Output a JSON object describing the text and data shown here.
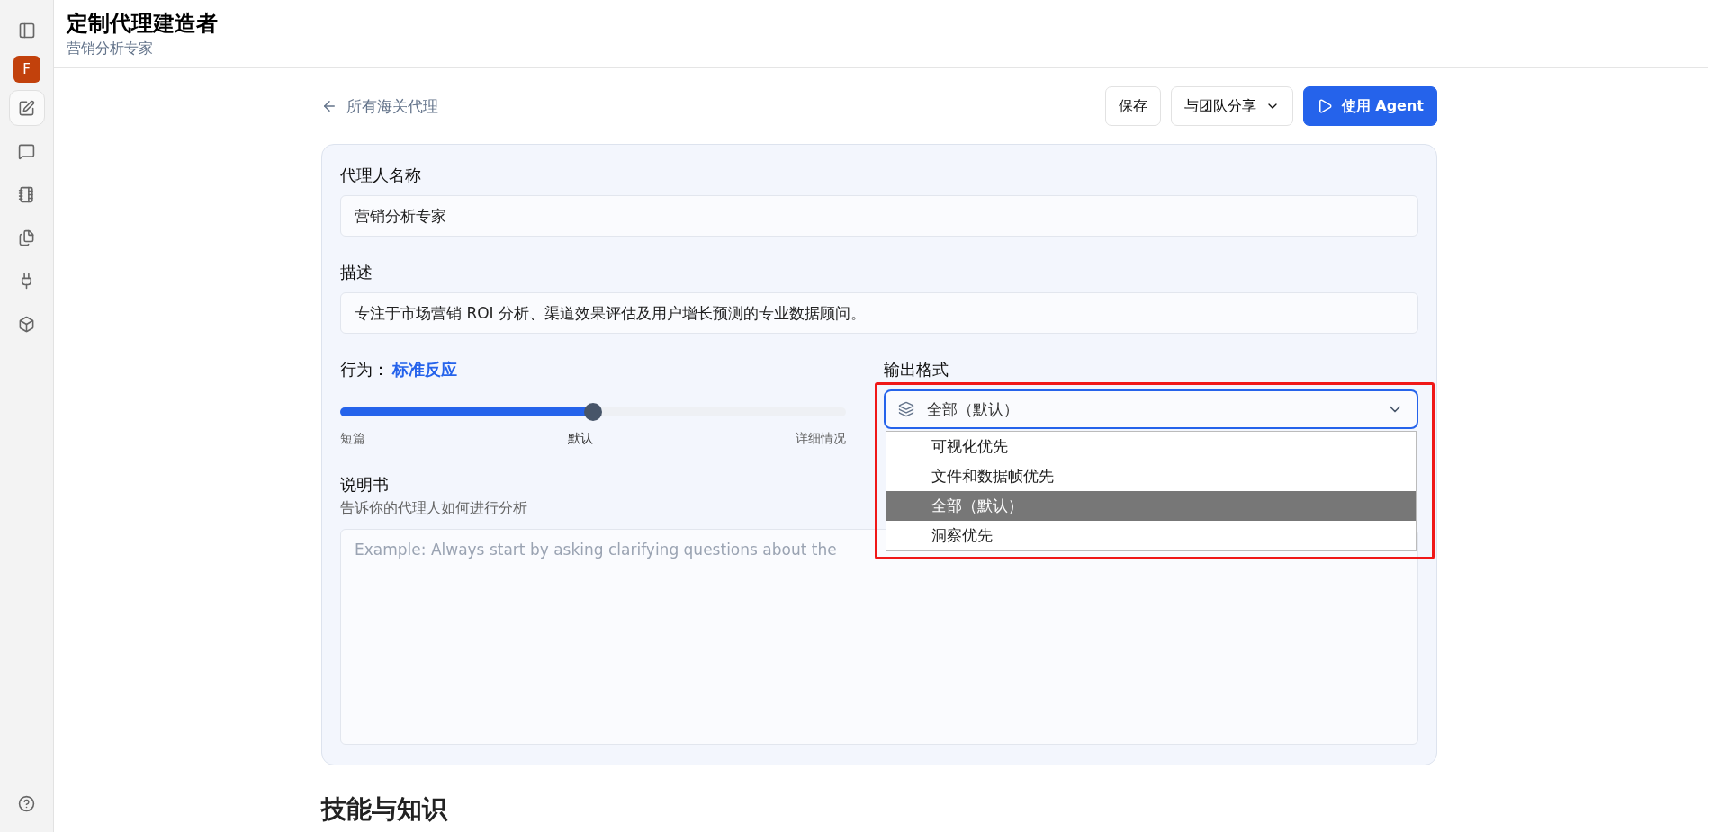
{
  "sidebar": {
    "avatar": "F",
    "items": [
      {
        "kind": "edit",
        "selected": true
      },
      {
        "kind": "chat",
        "selected": false
      },
      {
        "kind": "notebook",
        "selected": false
      },
      {
        "kind": "files",
        "selected": false
      },
      {
        "kind": "plug",
        "selected": false
      },
      {
        "kind": "box",
        "selected": false
      }
    ]
  },
  "header": {
    "title": "定制代理建造者",
    "subtitle": "营销分析专家"
  },
  "back_link": "所有海关代理",
  "buttons": [
    {
      "kind": "plain",
      "label": "保存"
    },
    {
      "kind": "menu",
      "label": "与团队分享"
    },
    {
      "kind": "primary",
      "label": "使用 Agent"
    }
  ],
  "form": {
    "name": {
      "label": "代理人名称",
      "value": "营销分析专家"
    },
    "description": {
      "label": "描述",
      "value": "专注于市场营销 ROI 分析、渠道效果评估及用户增长预测的专业数据顾问。"
    },
    "behavior": {
      "label": "行为：",
      "value": "标准反应",
      "level": 0.5,
      "ticks": [
        "短篇",
        "默认",
        "详细情况"
      ]
    },
    "output_format": {
      "label": "输出格式",
      "value": "全部（默认）",
      "expanded": true,
      "options": [
        {
          "label": "可视化优先",
          "selected": false
        },
        {
          "label": "文件和数据帧优先",
          "selected": false
        },
        {
          "label": "全部（默认）",
          "selected": true
        },
        {
          "label": "洞察优先",
          "selected": false
        }
      ]
    },
    "instructions": {
      "label": "说明书",
      "hint": "告诉你的代理人如何进行分析",
      "placeholder": "Example: Always start by asking clarifying questions about the"
    }
  },
  "section_heading": "技能与知识"
}
